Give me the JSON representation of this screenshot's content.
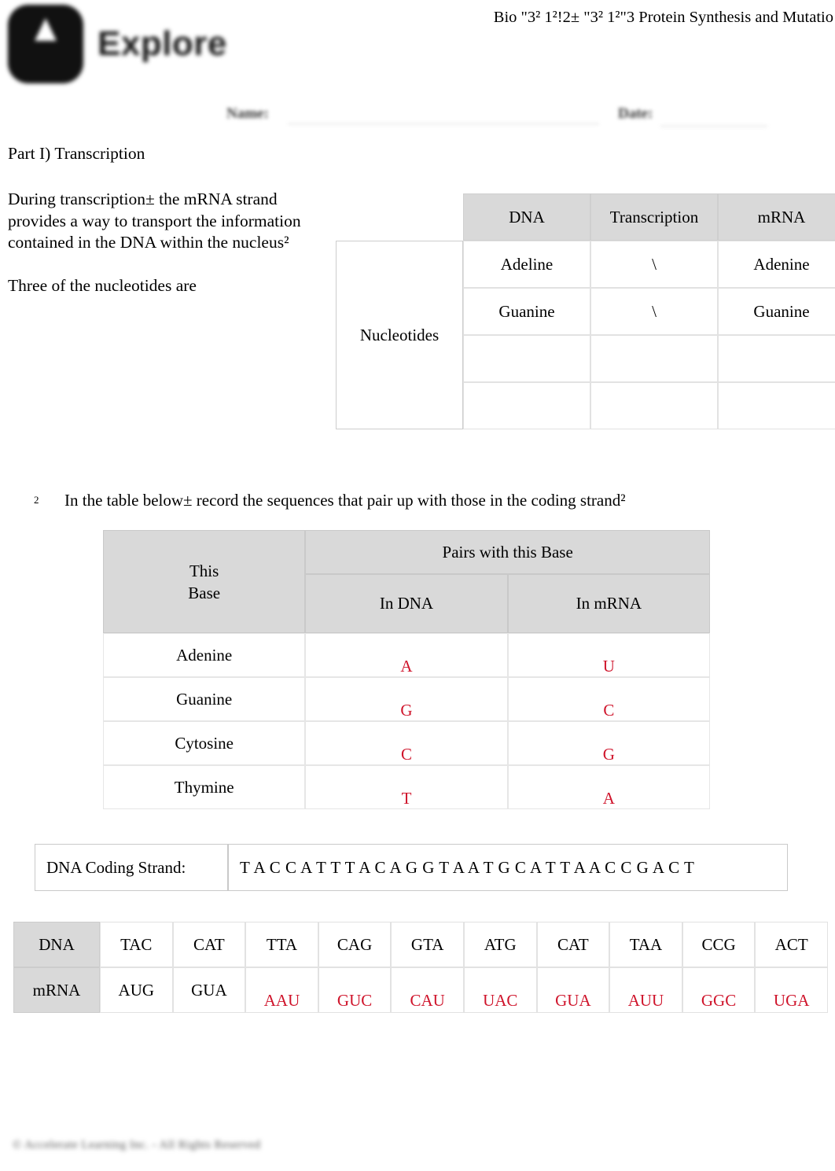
{
  "header": {
    "logo_word": "Explore",
    "doc_title": "Bio \"3² 1²!2± \"3² 1²\"3 Protein Synthesis and Mutatio"
  },
  "namedate": {
    "name_label": "Name:",
    "date_label": "Date:"
  },
  "body": {
    "part_title": "Part I) Transcription",
    "paragraph_1": "During transcription± the mRNA strand provides a way to transport the information contained in the DNA within the nucleus²",
    "paragraph_2": "Three of the nucleotides are",
    "numbered_marker": "2",
    "numbered_text": "In the table below± record the sequences that pair up with those in the coding strand²"
  },
  "colors": {
    "answer_red": "#cf142b",
    "header_gray": "#d9d9d9",
    "border_gray": "#e2e2e2"
  },
  "table_nucleotides": {
    "row_label": "Nucleotides",
    "columns": [
      "DNA",
      "Transcription",
      "mRNA"
    ],
    "rows": [
      {
        "dna": "Adeline",
        "transcription": "\\",
        "mrna": "Adenine"
      },
      {
        "dna": "Guanine",
        "transcription": "\\",
        "mrna": "Guanine"
      },
      {
        "dna": "",
        "transcription": "",
        "mrna": ""
      },
      {
        "dna": "",
        "transcription": "",
        "mrna": ""
      }
    ]
  },
  "table_pairs": {
    "col1_header_line1": "This",
    "col1_header_line2": "Base",
    "span_header": "Pairs with this Base",
    "sub_header_dna": "In DNA",
    "sub_header_mrna": "In mRNA",
    "rows": [
      {
        "base": "Adenine",
        "in_dna": "A",
        "in_mrna": "U"
      },
      {
        "base": "Guanine",
        "in_dna": "G",
        "in_mrna": "C"
      },
      {
        "base": "Cytosine",
        "in_dna": "C",
        "in_mrna": "G"
      },
      {
        "base": "Thymine",
        "in_dna": "T",
        "in_mrna": "A"
      }
    ]
  },
  "coding_strand": {
    "label": "DNA Coding Strand:",
    "sequence": "T A C C A T T T A C A G G T A A T G C A T T A A C C G A C T"
  },
  "codon_table": {
    "row_label_dna": "DNA",
    "row_label_mrna": "mRNA",
    "dna_codons": [
      "TAC",
      "CAT",
      "TTA",
      "CAG",
      "GTA",
      "ATG",
      "CAT",
      "TAA",
      "CCG",
      "ACT"
    ],
    "mrna_codons": [
      "AUG",
      "GUA",
      "AAU",
      "GUC",
      "CAU",
      "UAC",
      "GUA",
      "AUU",
      "GGC",
      "UGA"
    ],
    "mrna_prefilled_count": 2
  },
  "footer": {
    "copyright": "© Accelerate Learning Inc. - All Rights Reserved"
  }
}
